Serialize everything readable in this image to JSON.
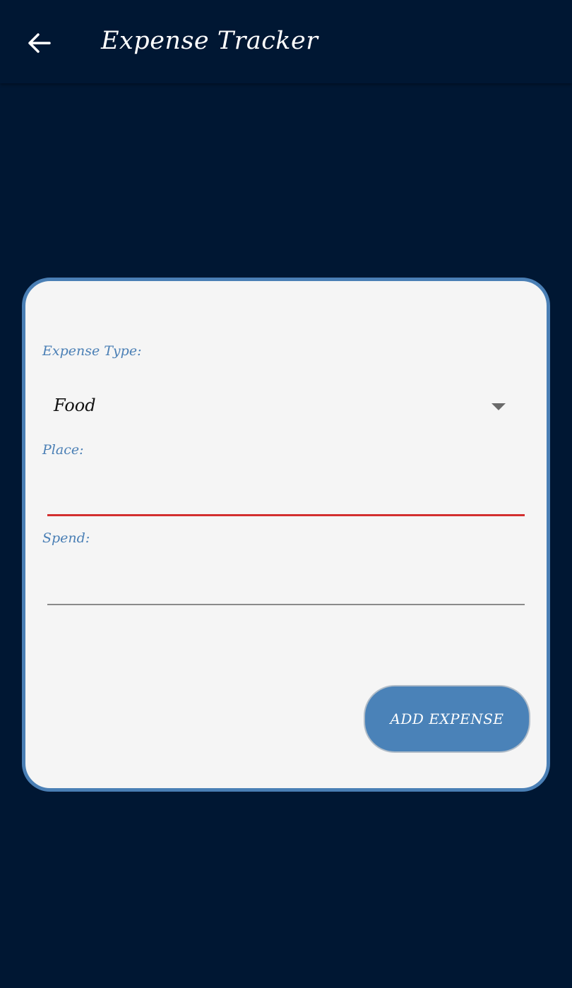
{
  "app_bar": {
    "title": "Expense Tracker",
    "back_icon": "arrow-left-icon"
  },
  "form": {
    "expense_type_label": "Expense Type:",
    "expense_type_value": "Food",
    "place_label": "Place:",
    "place_value": "",
    "spend_label": "Spend:",
    "spend_value": "",
    "submit_label": "ADD EXPENSE"
  },
  "colors": {
    "background": "#001733",
    "card": "#f5f5f5",
    "accent": "#4a7fb5",
    "error_underline": "#d32f2f"
  }
}
